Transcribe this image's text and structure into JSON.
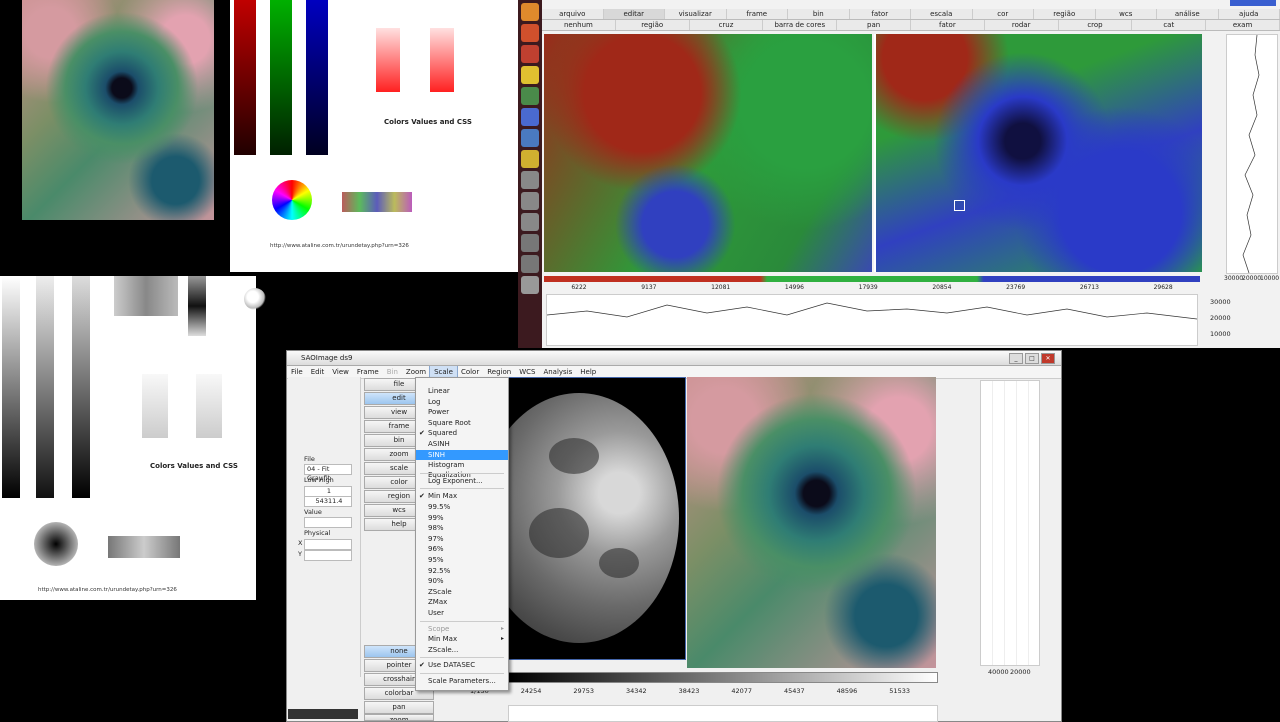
{
  "doc1": {
    "heading": "Colors Values and CSS",
    "url": "http://www.ataline.com.tr/urundetay.php?urn=326"
  },
  "doc2": {
    "heading": "Colors Values and CSS",
    "url": "http://www.ataline.com.tr/urundetay.php?urn=326"
  },
  "tr_window": {
    "menu_top": [
      "arquivo",
      "editar",
      "visualizar",
      "frame",
      "bin",
      "fator",
      "escala",
      "cor",
      "região",
      "wcs",
      "análise",
      "ajuda"
    ],
    "menu_bottom": [
      "nenhum",
      "região",
      "cruz",
      "barra de cores",
      "pan",
      "fator",
      "rodar",
      "crop",
      "cat",
      "exam"
    ],
    "colorbar_ticks": [
      "6222",
      "9137",
      "12081",
      "14996",
      "17939",
      "20854",
      "23769",
      "26713",
      "29628"
    ],
    "graph_right_ticks": [
      "30000",
      "20000",
      "10000"
    ],
    "graph_bottom_ticks": [
      "30000",
      "20000",
      "10000"
    ]
  },
  "ds9": {
    "title": "SAOImage ds9",
    "menu": [
      "File",
      "Edit",
      "View",
      "Frame",
      "Bin",
      "Zoom",
      "Scale",
      "Color",
      "Region",
      "WCS",
      "Analysis",
      "Help"
    ],
    "active_menu": "Scale",
    "buttons_top": [
      "file",
      "edit",
      "view",
      "frame",
      "bin",
      "zoom",
      "scale",
      "color",
      "region",
      "wcs",
      "help"
    ],
    "buttons_bottom": [
      "none",
      "pointer",
      "crosshair",
      "colorbar",
      "pan",
      "zoom"
    ],
    "selected_top": "edit",
    "selected_bottom": "none",
    "info": {
      "file_label": "File",
      "file_value": "04 - Fit Gray.fit",
      "lowhigh_label": "Low High",
      "low": "1",
      "high": "54311.4",
      "value_label": "Value",
      "physical_label": "Physical",
      "x_label": "X",
      "y_label": "Y"
    },
    "scale_menu": [
      {
        "label": "Linear",
        "check": false
      },
      {
        "label": "Log",
        "check": false
      },
      {
        "label": "Power",
        "check": false
      },
      {
        "label": "Square Root",
        "check": false
      },
      {
        "label": "Squared",
        "check": true
      },
      {
        "label": "ASINH",
        "check": false
      },
      {
        "label": "SINH",
        "check": false,
        "highlight": true
      },
      {
        "label": "Histogram Equalization",
        "check": false
      },
      {
        "sep": true
      },
      {
        "label": "Log Exponent...",
        "check": false
      },
      {
        "sep": true
      },
      {
        "label": "Min Max",
        "check": true
      },
      {
        "label": "99.5%",
        "check": false
      },
      {
        "label": "99%",
        "check": false
      },
      {
        "label": "98%",
        "check": false
      },
      {
        "label": "97%",
        "check": false
      },
      {
        "label": "96%",
        "check": false
      },
      {
        "label": "95%",
        "check": false
      },
      {
        "label": "92.5%",
        "check": false
      },
      {
        "label": "90%",
        "check": false
      },
      {
        "label": "ZScale",
        "check": false
      },
      {
        "label": "ZMax",
        "check": false
      },
      {
        "label": "User",
        "check": false
      },
      {
        "sep": true
      },
      {
        "label": "Scope",
        "check": false,
        "disabled": true,
        "submenu": true
      },
      {
        "label": "Min Max",
        "check": false,
        "submenu": true
      },
      {
        "label": "ZScale...",
        "check": false
      },
      {
        "sep": true
      },
      {
        "label": "Use DATASEC",
        "check": true
      },
      {
        "sep": true
      },
      {
        "label": "Scale Parameters...",
        "check": false
      }
    ],
    "colorbar_ticks": [
      "1/150",
      "24254",
      "29753",
      "34342",
      "38423",
      "42077",
      "45437",
      "48596",
      "51533"
    ],
    "graph_ticks": [
      "40000",
      "20000"
    ]
  }
}
